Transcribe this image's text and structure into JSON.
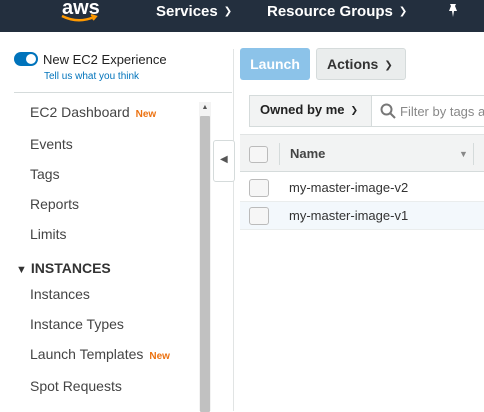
{
  "topbar": {
    "logo": "aws",
    "nav": [
      {
        "label": "Services"
      },
      {
        "label": "Resource Groups"
      }
    ],
    "pin_icon": "pin-icon"
  },
  "sidebar": {
    "experience_label": "New EC2 Experience",
    "experience_link": "Tell us what you think",
    "experience_toggle_on": true,
    "items": [
      {
        "label": "EC2 Dashboard",
        "badge": "New"
      },
      {
        "label": "Events"
      },
      {
        "label": "Tags"
      },
      {
        "label": "Reports"
      },
      {
        "label": "Limits"
      }
    ],
    "section": "INSTANCES",
    "section_items": [
      {
        "label": "Instances"
      },
      {
        "label": "Instance Types"
      },
      {
        "label": "Launch Templates",
        "badge": "New"
      },
      {
        "label": "Spot Requests"
      }
    ]
  },
  "toolbar": {
    "launch_label": "Launch",
    "actions_label": "Actions"
  },
  "filter": {
    "owner_selected": "Owned by me",
    "placeholder": "Filter by tags and attributes or search by keyword"
  },
  "table": {
    "columns": [
      "Name"
    ],
    "rows": [
      {
        "name": "my-master-image-v2"
      },
      {
        "name": "my-master-image-v1"
      }
    ]
  },
  "colors": {
    "topbar": "#232f3e",
    "accent": "#0073bb",
    "badge": "#ec7211",
    "launch_button": "#8cc3e9"
  }
}
